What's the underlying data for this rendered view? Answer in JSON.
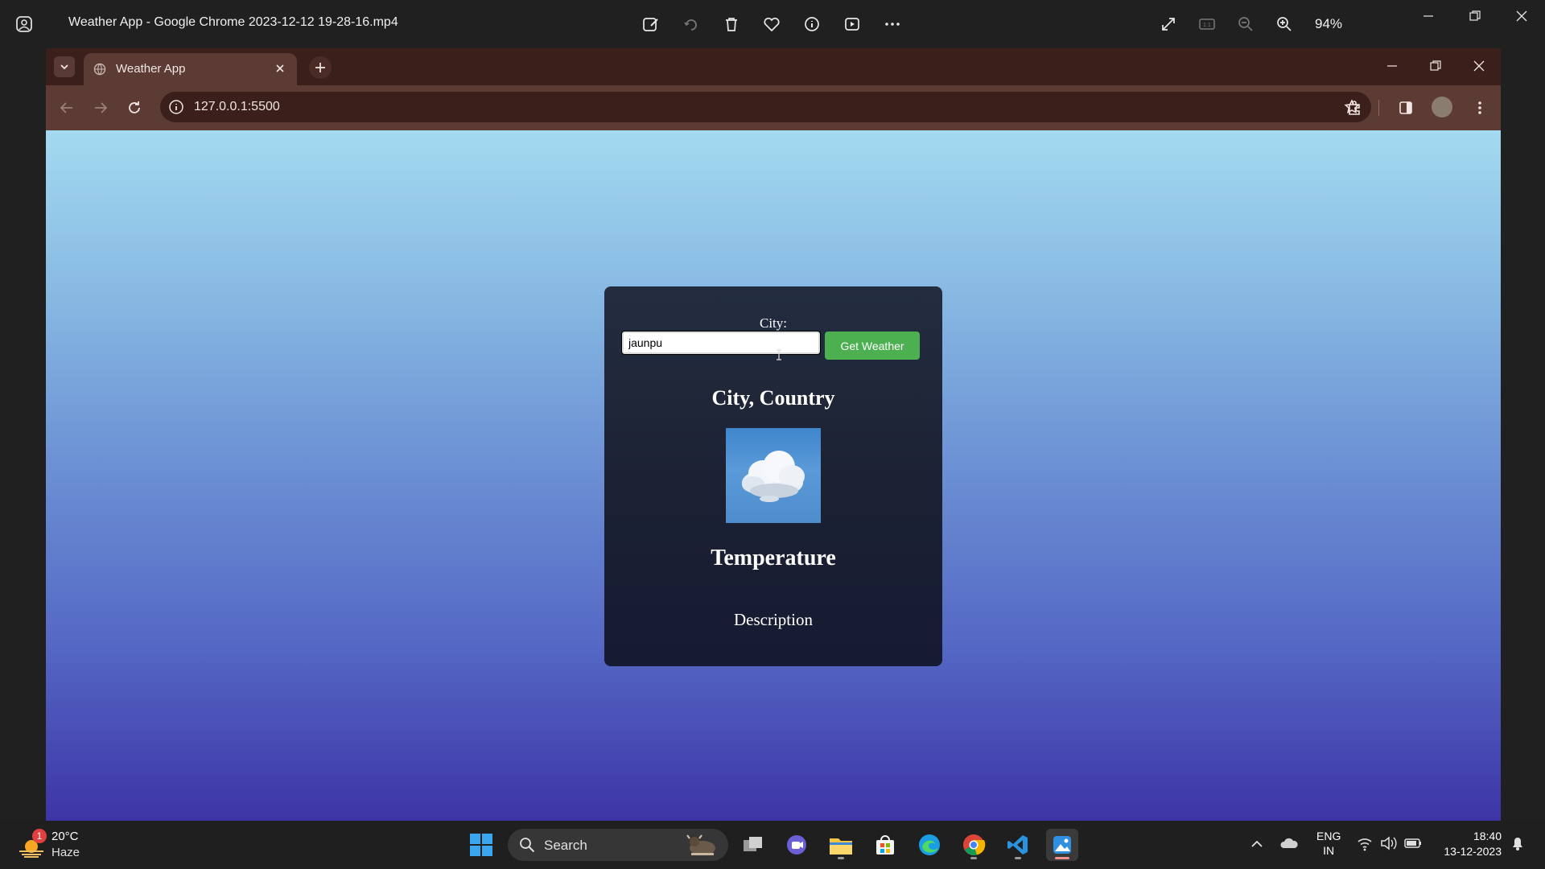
{
  "player": {
    "title": "Weather App - Google Chrome 2023-12-12 19-28-16.mp4",
    "zoom": "94%",
    "tools": [
      "edit-icon",
      "rotate-icon",
      "delete-icon",
      "favorite-icon",
      "info-icon",
      "slideshow-icon",
      "more-icon"
    ]
  },
  "browser": {
    "tab_title": "Weather App",
    "url": "127.0.0.1:5500"
  },
  "app": {
    "city_label": "City:",
    "city_input_value": "jaunpu",
    "button_label": "Get Weather",
    "city_country": "City, Country",
    "temperature": "Temperature",
    "description": "Description"
  },
  "taskbar": {
    "weather_temp": "20°C",
    "weather_cond": "Haze",
    "weather_badge": "1",
    "search_label": "Search",
    "lang_line1": "ENG",
    "lang_line2": "IN",
    "time": "18:40",
    "date": "13-12-2023"
  },
  "colors": {
    "button_green": "#4caf50",
    "card_dark": "#1c2233",
    "bg_top": "#a4daf0",
    "bg_bottom": "#3d34a6"
  }
}
